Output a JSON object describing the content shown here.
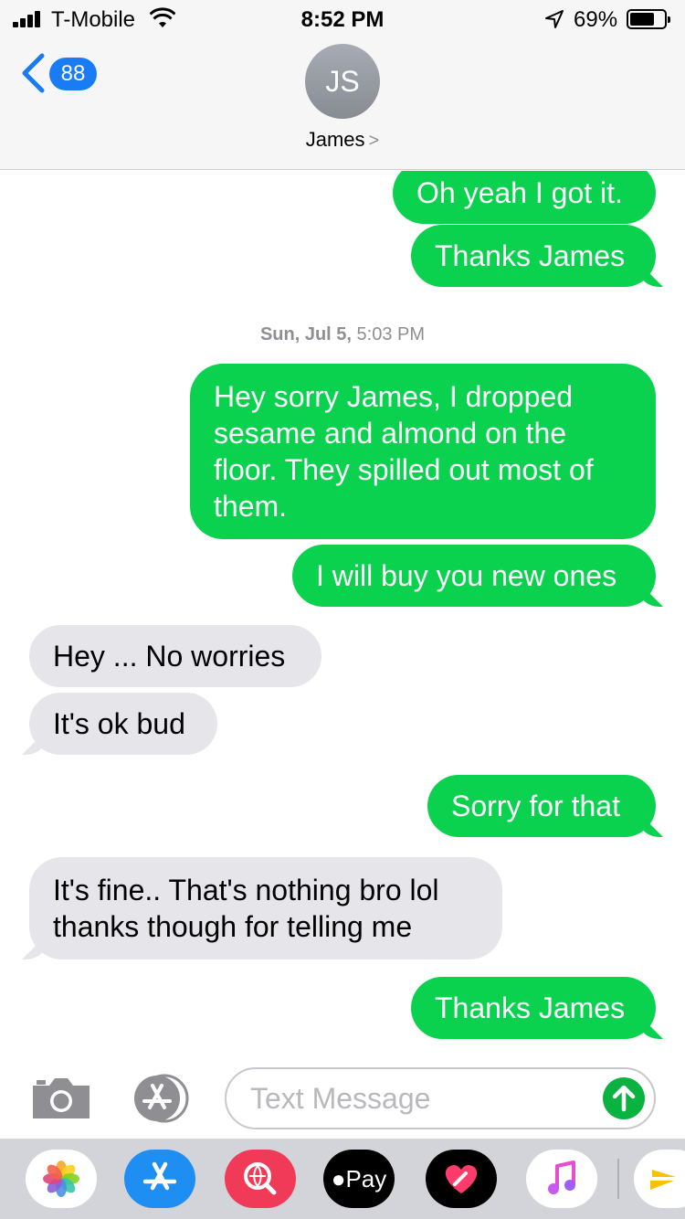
{
  "status_bar": {
    "carrier": "T-Mobile",
    "time": "8:52 PM",
    "battery_percent": "69%",
    "battery_level": 0.69
  },
  "header": {
    "back_badge": "88",
    "avatar_initials": "JS",
    "contact_name": "James"
  },
  "messages": [
    {
      "from": "me",
      "text": "Oh yeah I got it."
    },
    {
      "from": "me",
      "text": "Thanks James"
    },
    {
      "from": "me",
      "text": "Hey sorry James, I dropped sesame and almond on the floor. They spilled out most of them."
    },
    {
      "from": "me",
      "text": "I will buy you new ones"
    },
    {
      "from": "them",
      "text": "Hey ... No worries"
    },
    {
      "from": "them",
      "text": "It's ok bud"
    },
    {
      "from": "me",
      "text": "Sorry for that"
    },
    {
      "from": "them",
      "text": "It's fine.. That's nothing bro lol thanks though for telling me"
    },
    {
      "from": "me",
      "text": "Thanks James"
    }
  ],
  "timestamp": {
    "day": "Sun, Jul 5,",
    "time": "5:03 PM"
  },
  "input": {
    "placeholder": "Text Message"
  },
  "drawer": {
    "apple_pay_label": "Pay"
  },
  "colors": {
    "sent_bubble": "#0ad24f",
    "received_bubble": "#e5e5ea",
    "accent_blue": "#1a7cf5"
  },
  "icons": [
    "back-chevron-icon",
    "camera-icon",
    "app-store-icon",
    "send-arrow-icon",
    "photos-app-icon",
    "search-images-icon",
    "apple-pay-icon",
    "heart-sticker-icon",
    "music-icon",
    "sprint-icon"
  ]
}
